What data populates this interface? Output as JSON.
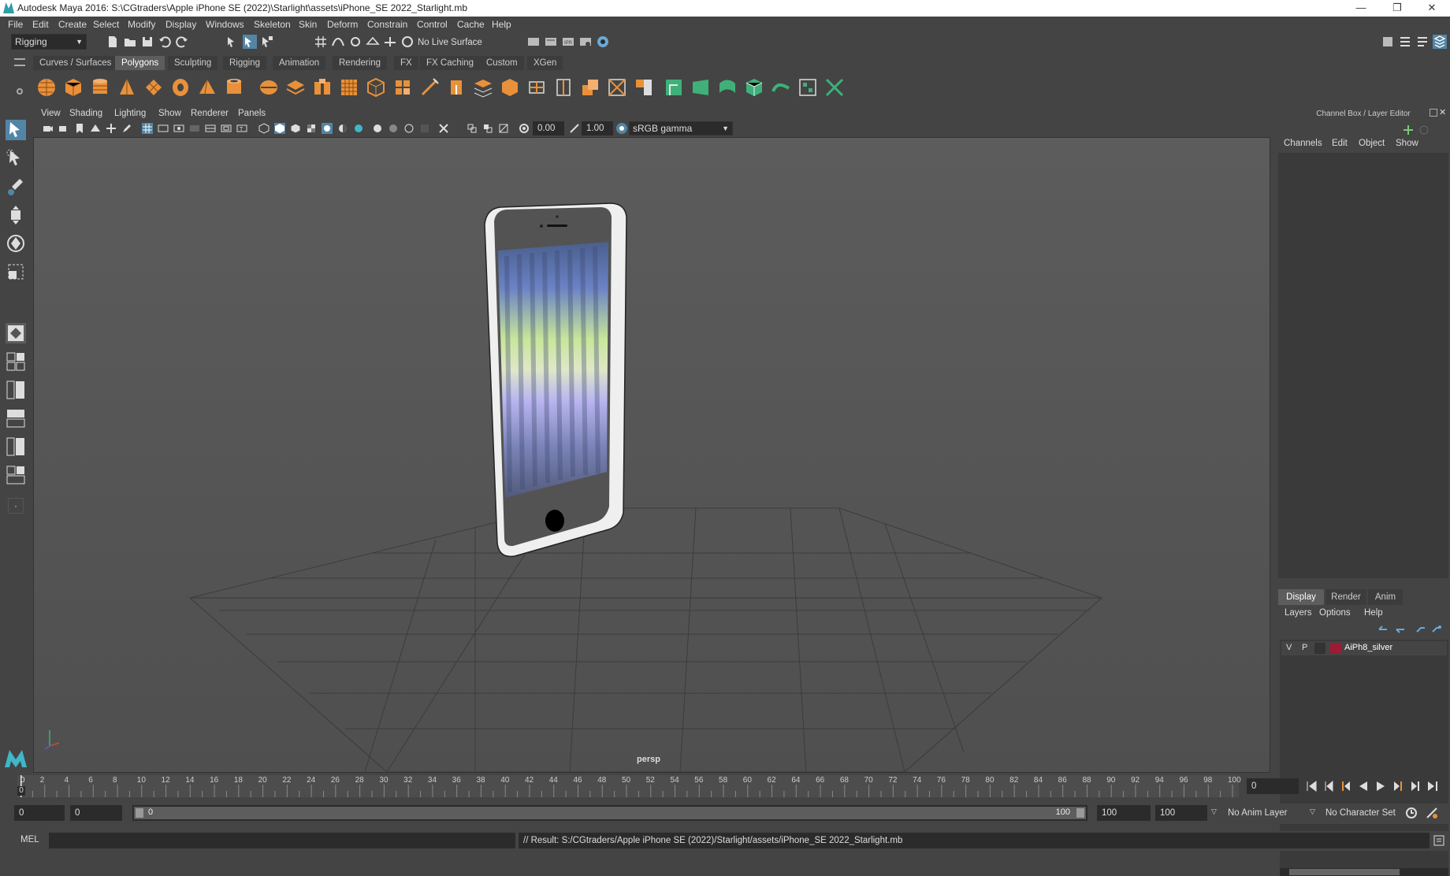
{
  "title": "Autodesk Maya 2016: S:\\CGtraders\\Apple iPhone SE (2022)\\Starlight\\assets\\iPhone_SE 2022_Starlight.mb",
  "window_controls": {
    "minimize": "—",
    "restore": "❐",
    "close": "✕"
  },
  "menus": [
    "File",
    "Edit",
    "Create",
    "Select",
    "Modify",
    "Display",
    "Windows",
    "Skeleton",
    "Skin",
    "Deform",
    "Constrain",
    "Control",
    "Cache",
    "Help"
  ],
  "status_line": {
    "menu_set": "Rigging",
    "live_surface": "No Live Surface"
  },
  "shelf_tabs": [
    "Curves / Surfaces",
    "Polygons",
    "Sculpting",
    "Rigging",
    "Animation",
    "Rendering",
    "FX",
    "FX Caching",
    "Custom",
    "XGen"
  ],
  "active_shelf_tab": "Polygons",
  "viewport": {
    "menus": [
      "View",
      "Shading",
      "Lighting",
      "Show",
      "Renderer",
      "Panels"
    ],
    "exposure": "0.00",
    "gamma": "1.00",
    "color_space": "sRGB gamma",
    "camera_label": "persp"
  },
  "channel_box": {
    "title": "Channel Box / Layer Editor",
    "menus": [
      "Channels",
      "Edit",
      "Object",
      "Show"
    ]
  },
  "layer_editor": {
    "tabs": [
      "Display",
      "Render",
      "Anim"
    ],
    "active_tab": "Display",
    "menus": [
      "Layers",
      "Options",
      "Help"
    ],
    "layers": [
      {
        "v": "V",
        "p": "P",
        "name": "AiPh8_silver",
        "color": "#9c1c34"
      }
    ]
  },
  "timeline": {
    "ticks": [
      "2",
      "4",
      "6",
      "8",
      "10",
      "12",
      "14",
      "16",
      "18",
      "20",
      "22",
      "24",
      "26",
      "28",
      "30",
      "32",
      "34",
      "36",
      "38",
      "40",
      "42",
      "44",
      "46",
      "48",
      "50",
      "52",
      "54",
      "56",
      "58",
      "60",
      "62",
      "64",
      "66",
      "68",
      "70",
      "72",
      "74",
      "76",
      "78",
      "80",
      "82",
      "84",
      "86",
      "88",
      "90",
      "92",
      "94",
      "96",
      "98",
      "100"
    ],
    "start_tick": "0",
    "current_frame_marker": "0",
    "current_frame": "0"
  },
  "range_slider": {
    "start": "0",
    "playback_start": "0",
    "inner_start": "0",
    "inner_end": "100",
    "playback_end": "100",
    "end": "100",
    "anim_layer": "No Anim Layer",
    "character_set": "No Character Set"
  },
  "command_line": {
    "mode": "MEL",
    "result": "// Result: S:/CGtraders/Apple iPhone SE (2022)/Starlight/assets/iPhone_SE 2022_Starlight.mb"
  },
  "colors": {
    "accent": "#5285a6",
    "shelf_icon": "#e8913a",
    "shelf_icon_green": "#3fb07a",
    "layer_color": "#9c1c34"
  }
}
